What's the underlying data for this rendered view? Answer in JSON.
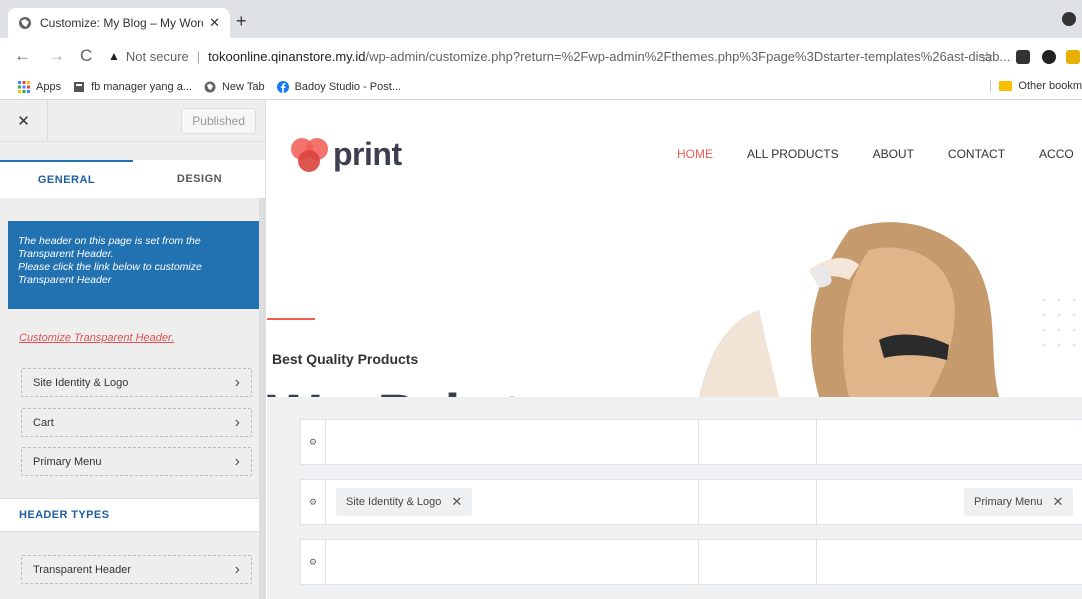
{
  "browser": {
    "tab_title": "Customize: My Blog – My WordP",
    "tab_close": "✕",
    "new_tab": "+",
    "back": "←",
    "forward": "→",
    "reload": "C",
    "security_icon": "warning-triangle-icon",
    "security_label": "Not secure",
    "url_host": "tokoonline.qinanstore.my.id",
    "url_path": "/wp-admin/customize.php?return=%2Fwp-admin%2Fthemes.php%3Fpage%3Dstarter-templates%26ast-disab...",
    "star": "☆",
    "bookmarks": [
      {
        "label": "Apps",
        "icon": "apps-grid-icon"
      },
      {
        "label": "fb manager yang a...",
        "icon": "page-icon"
      },
      {
        "label": "New Tab",
        "icon": "globe-icon"
      },
      {
        "label": "Badoy Studio - Post...",
        "icon": "facebook-icon"
      }
    ],
    "other_bookmarks": "Other bookm"
  },
  "sidebar": {
    "close": "✕",
    "published_label": "Published",
    "tabs": [
      {
        "label": "GENERAL",
        "active": true
      },
      {
        "label": "DESIGN",
        "active": false
      }
    ],
    "notice_line1": "The header on this page is set from the",
    "notice_line2": "Transparent Header.",
    "notice_line3": "Please click the link below to customize",
    "notice_line4": "Transparent Header",
    "customize_link": "Customize Transparent Header.",
    "items": [
      {
        "label": "Site Identity & Logo"
      },
      {
        "label": "Cart"
      },
      {
        "label": "Primary Menu"
      }
    ],
    "section_title": "HEADER TYPES",
    "section_items": [
      {
        "label": "Transparent Header"
      }
    ],
    "chevron": "›"
  },
  "preview": {
    "logo_text": "print",
    "menu": [
      {
        "label": "HOME",
        "active": true
      },
      {
        "label": "ALL PRODUCTS",
        "active": false
      },
      {
        "label": "ABOUT",
        "active": false
      },
      {
        "label": "CONTACT",
        "active": false
      },
      {
        "label": "ACCO",
        "active": false
      }
    ],
    "hero_subtitle": "Best Quality Products",
    "hero_title_partial": "We Print What"
  },
  "builder": {
    "gear": "⚙",
    "chips": {
      "site_identity": "Site Identity & Logo",
      "primary_menu": "Primary Menu",
      "remove": "✕"
    }
  },
  "colors": {
    "accent_blue": "#2271b1",
    "accent_red": "#f25c54",
    "logo_dark": "#3c3f4f"
  }
}
